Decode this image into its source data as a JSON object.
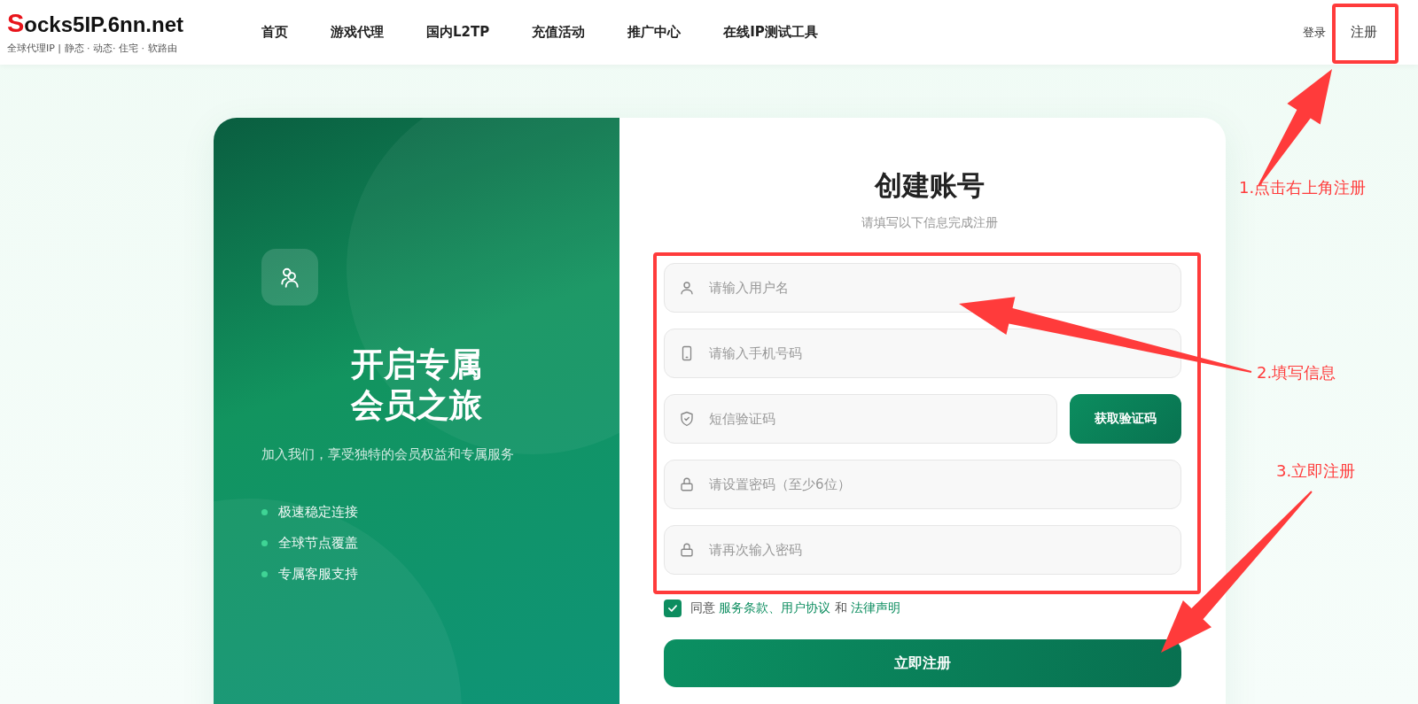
{
  "logo": {
    "name": "Socks5IP.6nn.net",
    "tagline": "全球代理IP | 静态 · 动态· 住宅 · 软路由"
  },
  "nav": [
    {
      "label": "首页"
    },
    {
      "label": "游戏代理"
    },
    {
      "label": "国内L2TP"
    },
    {
      "label": "充值活动"
    },
    {
      "label": "推广中心"
    },
    {
      "label": "在线IP测试工具"
    }
  ],
  "auth": {
    "login": "登录",
    "register": "注册"
  },
  "promo": {
    "title_lines": [
      "开启专属",
      "会员之旅"
    ],
    "subtitle": "加入我们，享受独特的会员权益和专属服务",
    "features": [
      "极速稳定连接",
      "全球节点覆盖",
      "专属客服支持"
    ]
  },
  "form": {
    "title": "创建账号",
    "subtitle": "请填写以下信息完成注册",
    "fields": [
      {
        "kind": "user",
        "placeholder": "请输入用户名"
      },
      {
        "kind": "phone",
        "placeholder": "请输入手机号码"
      },
      {
        "kind": "code",
        "placeholder": "短信验证码",
        "button": "获取验证码"
      },
      {
        "kind": "lock",
        "placeholder": "请设置密码（至少6位）"
      },
      {
        "kind": "lock",
        "placeholder": "请再次输入密码"
      }
    ],
    "agreement": {
      "checked": true,
      "parts": [
        {
          "kind": "text",
          "text": "同意"
        },
        {
          "kind": "link",
          "text": "服务条款、用户协议"
        },
        {
          "kind": "text",
          "text": "和"
        },
        {
          "kind": "link",
          "text": "法律声明"
        }
      ]
    },
    "submit": "立即注册"
  },
  "annotations": [
    {
      "text": "1.点击右上角注册"
    },
    {
      "text": "2.填写信息"
    },
    {
      "text": "3.立即注册"
    }
  ]
}
